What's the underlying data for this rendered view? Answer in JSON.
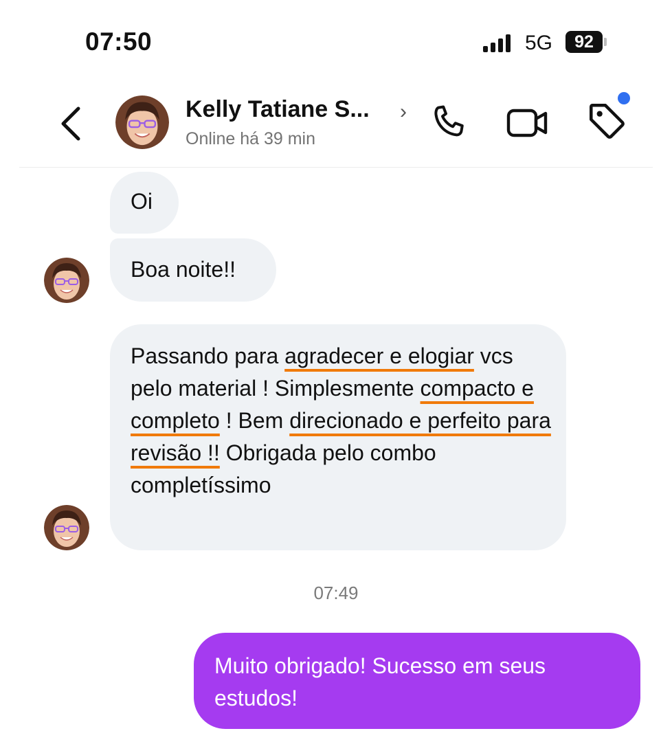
{
  "status_bar": {
    "time": "07:50",
    "network": "5G",
    "battery": "92"
  },
  "header": {
    "contact_name": "Kelly Tatiane S...",
    "chevron": "›",
    "presence": "Online há 39 min"
  },
  "messages": {
    "m1": "Oi",
    "m2": "Boa noite!!",
    "m3": {
      "t1": "Passando para ",
      "u1": "agradecer e elogiar",
      "t2": " vcs pelo material ! Simplesmente ",
      "u2": "compacto e completo",
      "t3": " ! Bem ",
      "u3": "direcionado e perfeito para revisão !!",
      "t4": " Obrigada pelo combo completíssimo"
    },
    "timestamp": "07:49",
    "m4": "Muito obrigado! Sucesso em seus estudos!"
  },
  "colors": {
    "outgoing_bubble": "#a53bf0",
    "incoming_bubble": "#eff2f5",
    "underline": "#f07a0a",
    "notification_dot": "#2f6ff0"
  },
  "icons": [
    "back-chevron-icon",
    "phone-icon",
    "video-camera-icon",
    "tag-icon",
    "signal-icon",
    "battery-icon"
  ]
}
